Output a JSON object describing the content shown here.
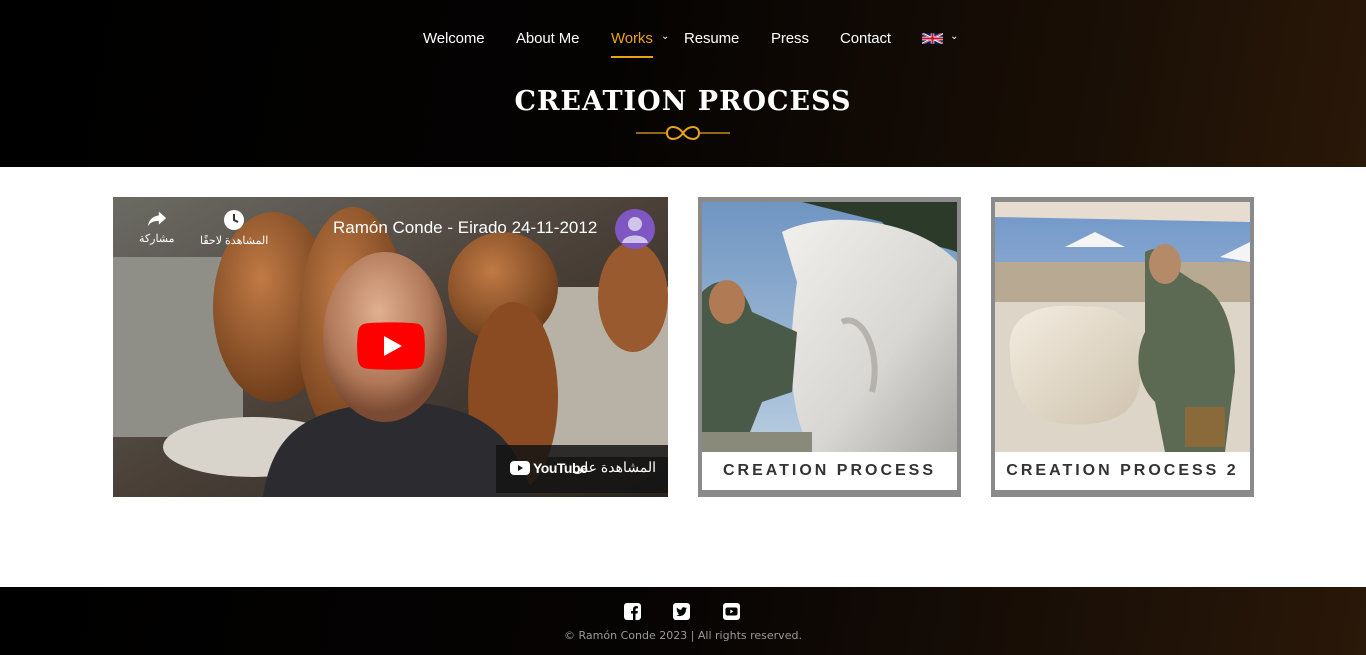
{
  "nav": {
    "items": [
      {
        "label": "Welcome"
      },
      {
        "label": "About Me"
      },
      {
        "label": "Works"
      },
      {
        "label": "Resume"
      },
      {
        "label": "Press"
      },
      {
        "label": "Contact"
      }
    ],
    "active_item": "Works",
    "language_flag": "uk-flag-icon"
  },
  "page": {
    "title": "CREATION PROCESS",
    "ornament_icon": "infinity-ornament-icon"
  },
  "video": {
    "title": "Ramón Conde - Eirado 24-11-2012",
    "share_label": "مشاركة",
    "watch_later_label": "المشاهدة لاحقًا",
    "watch_on_label": "المشاهدة على",
    "youtube_label": "YouTube"
  },
  "cards": [
    {
      "label": "CREATION PROCESS"
    },
    {
      "label": "CREATION PROCESS 2"
    }
  ],
  "footer": {
    "social_icons": [
      "facebook-icon",
      "twitter-icon",
      "youtube-icon"
    ],
    "copyright": "© Ramón Conde 2023 | All rights reserved."
  },
  "colors": {
    "accent": "#e8a418",
    "header_bg": "#000000",
    "youtube_red": "#ff0000"
  }
}
